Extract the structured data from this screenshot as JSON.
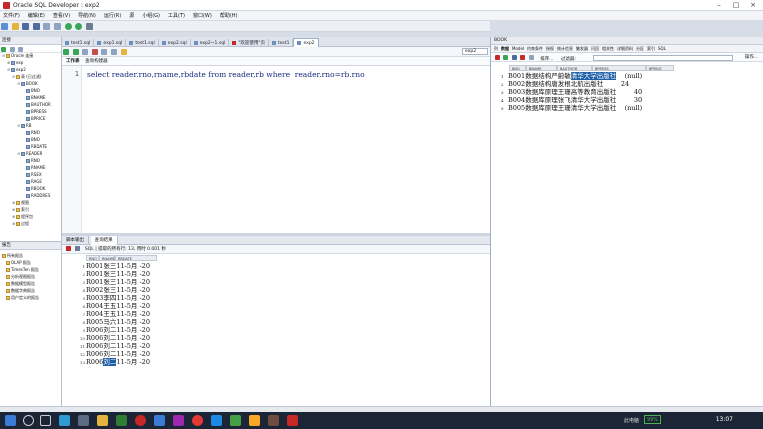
{
  "window": {
    "title": "Oracle SQL Developer : exp2"
  },
  "menu": [
    "文件(F)",
    "编辑(E)",
    "查看(V)",
    "导航(N)",
    "运行(R)",
    "源",
    "小组(G)",
    "工具(T)",
    "窗口(W)",
    "帮助(H)"
  ],
  "tabs": [
    {
      "label": "test1.sql",
      "active": false,
      "warn": false
    },
    {
      "label": "exp1.sql",
      "active": false,
      "warn": false
    },
    {
      "label": "test1.sql",
      "active": false,
      "warn": false
    },
    {
      "label": "exp2.sql",
      "active": false,
      "warn": false
    },
    {
      "label": "exp2~1.sql",
      "active": false,
      "warn": false
    },
    {
      "label": "\"欢迎使用\"页",
      "active": false,
      "warn": true
    },
    {
      "label": "test1",
      "active": false,
      "warn": false
    },
    {
      "label": "exp2",
      "active": true,
      "warn": false
    }
  ],
  "left": {
    "panel_title": "连接",
    "tree": [
      {
        "label": "Oracle 连接",
        "depth": 0,
        "folder": true,
        "toggle": "⊖"
      },
      {
        "label": "exp",
        "depth": 1,
        "folder": false,
        "toggle": "⊕"
      },
      {
        "label": "exp2",
        "depth": 1,
        "folder": false,
        "toggle": "⊖"
      },
      {
        "label": "表 (已过滤)",
        "depth": 2,
        "folder": true,
        "toggle": "⊖"
      },
      {
        "label": "BOOK",
        "depth": 3,
        "folder": false,
        "toggle": "⊖"
      },
      {
        "label": "BNO",
        "depth": 4,
        "folder": false,
        "toggle": ""
      },
      {
        "label": "BNAME",
        "depth": 4,
        "folder": false,
        "toggle": ""
      },
      {
        "label": "BAUTHOR",
        "depth": 4,
        "folder": false,
        "toggle": ""
      },
      {
        "label": "BPRESS",
        "depth": 4,
        "folder": false,
        "toggle": ""
      },
      {
        "label": "BPRICE",
        "depth": 4,
        "folder": false,
        "toggle": ""
      },
      {
        "label": "RB",
        "depth": 3,
        "folder": false,
        "toggle": "⊖"
      },
      {
        "label": "RNO",
        "depth": 4,
        "folder": false,
        "toggle": ""
      },
      {
        "label": "BNO",
        "depth": 4,
        "folder": false,
        "toggle": ""
      },
      {
        "label": "RBDATE",
        "depth": 4,
        "folder": false,
        "toggle": ""
      },
      {
        "label": "READER",
        "depth": 3,
        "folder": false,
        "toggle": "⊖"
      },
      {
        "label": "RNO",
        "depth": 4,
        "folder": false,
        "toggle": ""
      },
      {
        "label": "RNAME",
        "depth": 4,
        "folder": false,
        "toggle": ""
      },
      {
        "label": "RSEX",
        "depth": 4,
        "folder": false,
        "toggle": ""
      },
      {
        "label": "RAGE",
        "depth": 4,
        "folder": false,
        "toggle": ""
      },
      {
        "label": "RBOOK",
        "depth": 4,
        "folder": false,
        "toggle": ""
      },
      {
        "label": "RADDRES",
        "depth": 4,
        "folder": false,
        "toggle": ""
      },
      {
        "label": "视图",
        "depth": 2,
        "folder": true,
        "toggle": "⊕"
      },
      {
        "label": "索引",
        "depth": 2,
        "folder": true,
        "toggle": "⊕"
      },
      {
        "label": "程序包",
        "depth": 2,
        "folder": true,
        "toggle": "⊕"
      },
      {
        "label": "过程",
        "depth": 2,
        "folder": true,
        "toggle": "⊕"
      }
    ],
    "reports_title": "报告",
    "reports": [
      "所有报告",
      "OLAP 报告",
      "TimesTen 报告",
      "分析视图报告",
      "数据模型报告",
      "数据字典报告",
      "用户定义的报告"
    ]
  },
  "editor": {
    "toolbar_conn": "exp2",
    "subtabs": [
      "工作表",
      "查询构建器"
    ],
    "line_number": "1",
    "sql_parts": [
      "select",
      " reader.rno,rname,rbdate ",
      "from",
      " reader,rb ",
      "where",
      "  reader.rno=rb.rno"
    ]
  },
  "results": {
    "tabs": [
      "脚本输出",
      "查询结果"
    ],
    "info": "SQL | 提取的所有行: 13, 用时 0.001 秒",
    "columns": [
      "RNO",
      "RNAME",
      "RBDATE"
    ],
    "rows": [
      [
        "R001",
        "张三",
        "11-5月 -20"
      ],
      [
        "R001",
        "张三",
        "11-5月 -20"
      ],
      [
        "R001",
        "张三",
        "11-5月 -20"
      ],
      [
        "R002",
        "张三",
        "11-5月 -20"
      ],
      [
        "R003",
        "李四",
        "11-5月 -20"
      ],
      [
        "R004",
        "王五",
        "11-5月 -20"
      ],
      [
        "R004",
        "王五",
        "11-5月 -20"
      ],
      [
        "R005",
        "马六",
        "11-5月 -20"
      ],
      [
        "R006",
        "刘二",
        "11-5月 -20"
      ],
      [
        "R006",
        "刘二",
        "11-5月 -20"
      ],
      [
        "R006",
        "刘二",
        "11-5月 -20"
      ],
      [
        "R006",
        "刘二",
        "11-5月 -20"
      ],
      [
        "R006",
        "刘二",
        "11-5月 -20"
      ]
    ],
    "selected_row": 12
  },
  "book": {
    "title": "BOOK",
    "tabs": [
      "列",
      "数据",
      "Model",
      "约束条件",
      "授权",
      "统计信息",
      "触发器",
      "闪回",
      "相关性",
      "详细资料",
      "分区",
      "索引",
      "SQL"
    ],
    "tools_label": "排序...",
    "filter_label": "过滤器:",
    "ops_label": "操作...",
    "columns": [
      "BNO",
      "BNAME",
      "BAUTHOR",
      "BPRESS",
      "BPRICE"
    ],
    "rows": [
      [
        "B001",
        "数据结构",
        "严蔚敏",
        "清华大学出版社",
        "(null)"
      ],
      [
        "B002",
        "数据结构",
        "唐发根",
        "北航出版社",
        "24"
      ],
      [
        "B003",
        "数据库原理",
        "王珊",
        "高等教育出版社",
        "40"
      ],
      [
        "B004",
        "数据库原理",
        "张飞",
        "清华大学出版社",
        "30"
      ],
      [
        "B005",
        "数据库原理",
        "王珊",
        "清华大学出版社",
        "(null)"
      ]
    ],
    "selected_cell": [
      0,
      3
    ]
  },
  "taskbar": {
    "battery": "99%",
    "clock": "13:07",
    "tray": "此电脑"
  }
}
